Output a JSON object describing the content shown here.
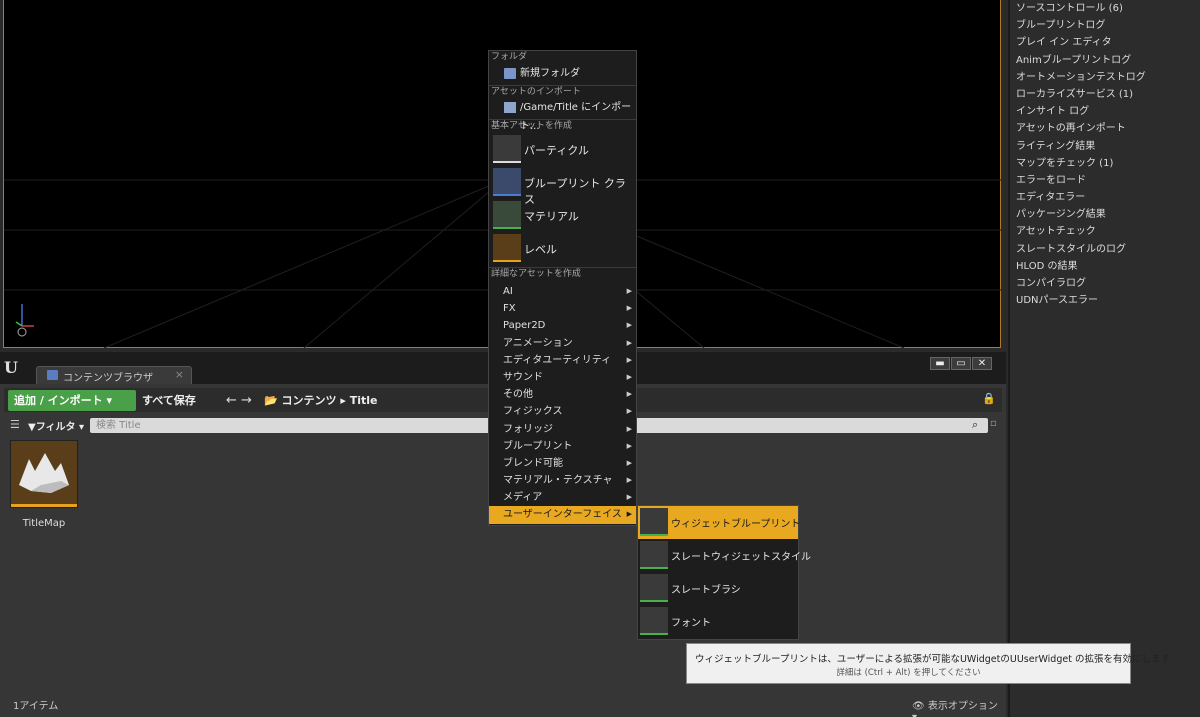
{
  "right_log_list": [
    "ソースコントロール (6)",
    "ブループリントログ",
    "プレイ イン エディタ",
    "Animブループリントログ",
    "オートメーションテストログ",
    "ローカライズサービス (1)",
    "インサイト ログ",
    "アセットの再インポート",
    "ライティング結果",
    "マップをチェック (1)",
    "エラーをロード",
    "エディタエラー",
    "パッケージング結果",
    "アセットチェック",
    "スレートスタイルのログ",
    "HLOD の結果",
    "コンパイラログ",
    "UDNパースエラー"
  ],
  "content_browser": {
    "tab_label": "コンテンツブラウザ",
    "tab_close": "×",
    "window_buttons": [
      "▬",
      "▭",
      "✕"
    ],
    "add_import_label": "追加 / インポート ▾",
    "save_all_label": "すべて保存",
    "nav_arrows": "← →",
    "breadcrumb": "📂  コンテンツ  ▸  Title",
    "filter_label": "▼フィルタ ▾",
    "search_placeholder": "検索 Title",
    "asset_name": "TitleMap",
    "item_count": "1アイテム",
    "view_options": "👁 表示オプション ▾"
  },
  "context_menu": {
    "sec_folder": "フォルダ",
    "new_folder": "新規フォルダ",
    "sec_import": "アセットのインポート",
    "import_to": "/Game/Title にインポート...",
    "sec_basic": "基本アセットを作成",
    "basic": [
      "パーティクル",
      "ブループリント クラス",
      "マテリアル",
      "レベル"
    ],
    "sec_advanced": "詳細なアセットを作成",
    "advanced": [
      "AI",
      "FX",
      "Paper2D",
      "アニメーション",
      "エディタユーティリティ",
      "サウンド",
      "その他",
      "フィジックス",
      "フォリッジ",
      "ブループリント",
      "ブレンド可能",
      "マテリアル・テクスチャ",
      "メディア",
      "ユーザーインターフェイス"
    ],
    "arrow": "▶"
  },
  "sub_menu": [
    "ウィジェットブループリント",
    "スレートウィジェットスタイル",
    "スレートブラシ",
    "フォント"
  ],
  "tooltip": {
    "line1": "ウィジェットブループリントは、ユーザーによる拡張が可能なUWidgetのUUserWidget の拡張を有効にします",
    "line2": "詳細は (Ctrl + Alt) を押してください"
  },
  "colors": {
    "accent": "#e8a820",
    "add_button": "#4aa048",
    "viewport_border": "#b07820"
  }
}
